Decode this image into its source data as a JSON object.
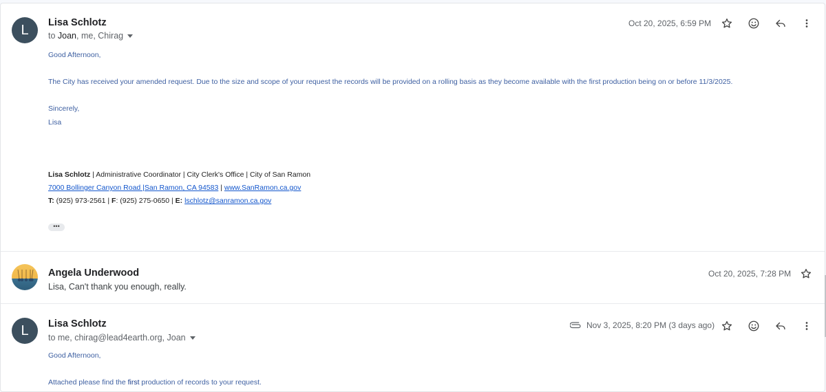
{
  "messages": [
    {
      "avatar_letter": "L",
      "sender": "Lisa Schlotz",
      "recipients_prefix": "to ",
      "recipients_bold": "Joan",
      "recipients_rest": ", me, Chirag",
      "date": "Oct 20, 2025, 6:59 PM",
      "greeting": "Good Afternoon,",
      "paragraph": "The City has received your amended request. Due to the size and scope of your request the records will be provided on a rolling basis as they become available with the first production being on or before 11/3/2025.",
      "closing": "Sincerely,",
      "signoff": "Lisa",
      "signature": {
        "name": "Lisa Schlotz",
        "title_line": " | Administrative Coordinator | City Clerk's Office | City of San Ramon",
        "address_link": "7000 Bollinger Canyon Road |San Ramon, CA 94583",
        "sep": " | ",
        "web_link": "www.SanRamon.ca.gov",
        "t_label": "T:",
        "t_value": " (925) 973-2561 | ",
        "f_label": "F",
        "f_value": ": (925) 275-0650 | ",
        "e_label": "E:",
        "email_link": "lschlotz@sanramon.ca.gov"
      },
      "trimmed_label": "•••"
    },
    {
      "sender": "Angela Underwood",
      "date": "Oct 20, 2025, 7:28 PM",
      "snippet": "Lisa, Can't thank you enough, really."
    },
    {
      "avatar_letter": "L",
      "sender": "Lisa Schlotz",
      "recipients": "to me, chirag@lead4earth.org, Joan",
      "date": "Nov 3, 2025, 8:20 PM (3 days ago)",
      "greeting": "Good Afternoon,",
      "attached_pre": "Attached please find the ",
      "attached_bold": "first",
      "attached_post": " production of records to your request."
    }
  ],
  "icons": [
    "star-icon",
    "emoji-icon",
    "reply-icon",
    "more-vert-icon",
    "attachment-icon"
  ],
  "colors": {
    "avatar": "#3c4f5e",
    "body_text": "#3d5fa1",
    "link": "#1155cc"
  }
}
